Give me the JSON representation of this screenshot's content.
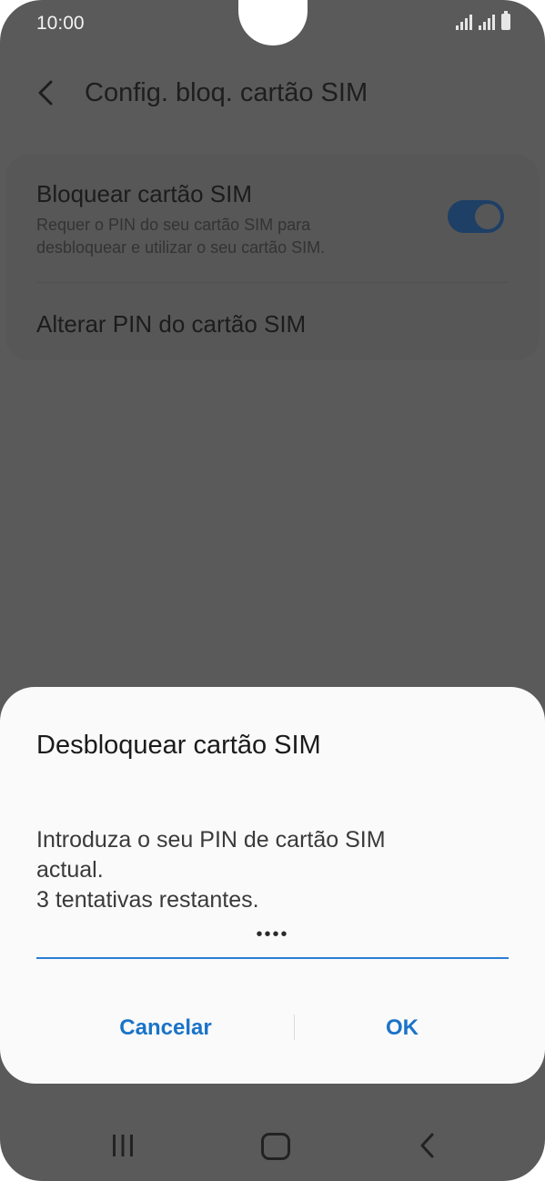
{
  "status_bar": {
    "time": "10:00"
  },
  "header": {
    "title": "Config. bloq. cartão SIM"
  },
  "settings": {
    "lock_sim": {
      "title": "Bloquear cartão SIM",
      "subtitle_line1": "Requer o PIN do seu cartão SIM para",
      "subtitle_line2": "desbloquear e utilizar o seu cartão SIM.",
      "enabled": true
    },
    "change_pin": {
      "title": "Alterar PIN do cartão SIM"
    }
  },
  "dialog": {
    "title": "Desbloquear cartão SIM",
    "message_line1": "Introduza o seu PIN de cartão SIM",
    "message_line2": "actual.",
    "message_line3": "3 tentativas restantes.",
    "pin_value": "••••",
    "cancel_label": "Cancelar",
    "ok_label": "OK"
  },
  "colors": {
    "accent": "#1a73c7",
    "input_underline": "#2a7fd4",
    "scrim_background": "#5a5a5a"
  },
  "nav_bar": {
    "icons": [
      "recent-apps-icon",
      "home-icon",
      "back-icon"
    ]
  }
}
